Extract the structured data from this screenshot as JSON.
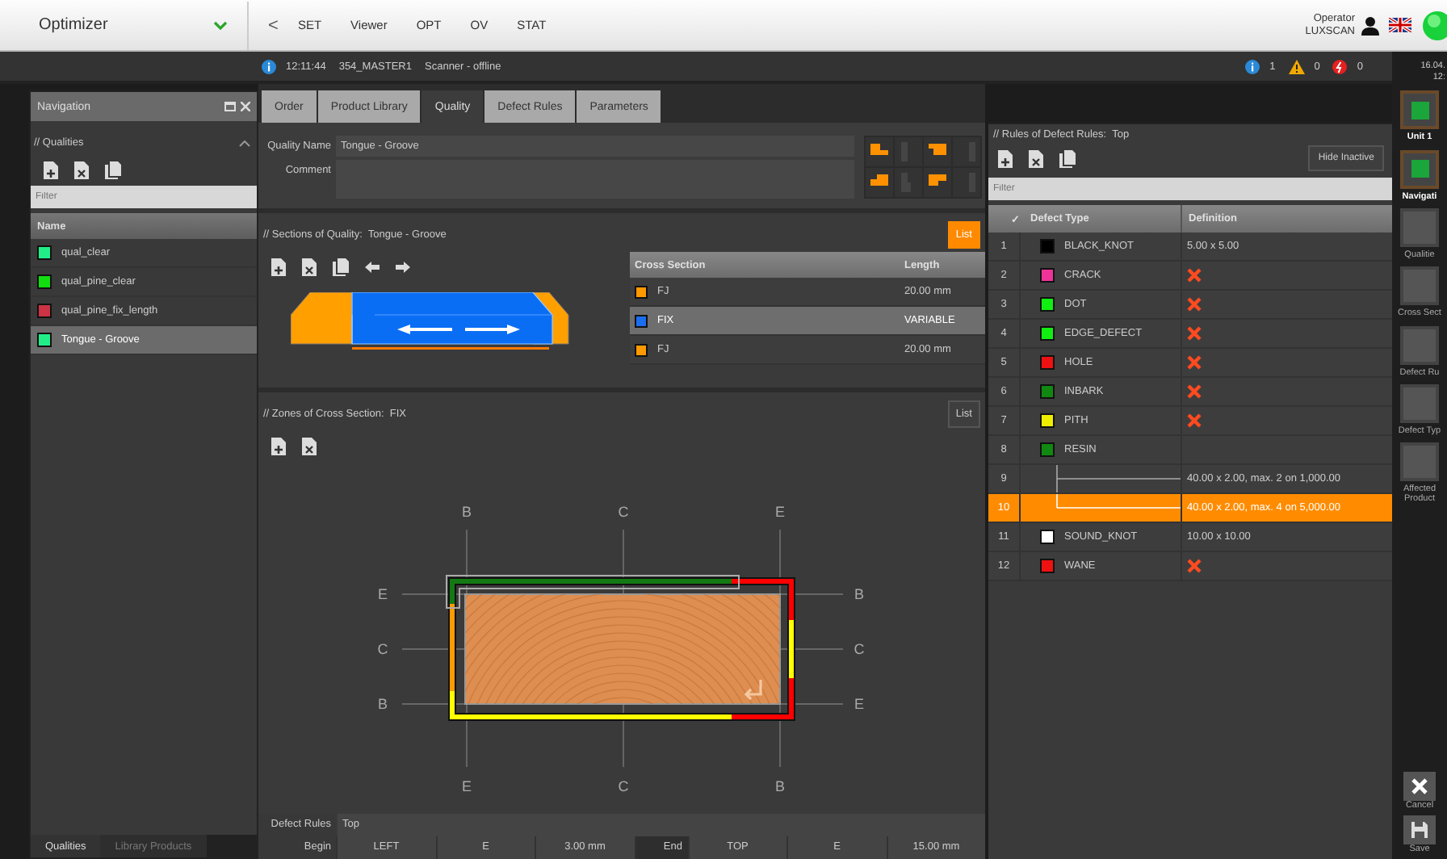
{
  "app": {
    "title": "Optimizer",
    "back": "<",
    "menu": [
      "SET",
      "Viewer",
      "OPT",
      "OV",
      "STAT"
    ],
    "operator_label": "Operator",
    "operator_name": "LUXSCAN"
  },
  "status_bar": {
    "time": "12:11:44",
    "master": "354_MASTER1",
    "scanner": "Scanner - offline",
    "info_count": "1",
    "warning_count": "0",
    "error_count": "0"
  },
  "navigation": {
    "title": "Navigation",
    "section": "// Qualities",
    "expanded": true,
    "filter_placeholder": "Filter",
    "column": "Name",
    "items": [
      {
        "name": "qual_clear",
        "color": "#22ee88",
        "selected": false
      },
      {
        "name": "qual_pine_clear",
        "color": "#11dd11",
        "selected": false
      },
      {
        "name": "qual_pine_fix_length",
        "color": "#cc3344",
        "selected": false
      },
      {
        "name": "Tongue - Groove",
        "color": "#22ee88",
        "selected": true
      }
    ],
    "tabs": [
      {
        "label": "Qualities",
        "selected": true
      },
      {
        "label": "Library Products",
        "selected": false
      }
    ]
  },
  "tabs": [
    {
      "label": "Order",
      "selected": false
    },
    {
      "label": "Product Library",
      "selected": false
    },
    {
      "label": "Quality",
      "selected": true
    },
    {
      "label": "Defect Rules",
      "selected": false
    },
    {
      "label": "Parameters",
      "selected": false
    }
  ],
  "quality": {
    "name_label": "Quality Name",
    "name": "Tongue - Groove",
    "comment_label": "Comment",
    "profiles": [
      {
        "active": true
      },
      {
        "active": false
      },
      {
        "active": true
      },
      {
        "active": false
      },
      {
        "active": true
      },
      {
        "active": false
      },
      {
        "active": true
      },
      {
        "active": false
      }
    ]
  },
  "sections": {
    "title": "// Sections of Quality:",
    "quality": "Tongue - Groove",
    "list_button": "List",
    "list_active": true,
    "columns": [
      "Cross Section",
      "Length"
    ],
    "rows": [
      {
        "name": "FJ",
        "length": "20.00 mm",
        "color": "#ff9900",
        "selected": false
      },
      {
        "name": "FIX",
        "length": "VARIABLE",
        "color": "#1a6ef0",
        "selected": true
      },
      {
        "name": "FJ",
        "length": "20.00 mm",
        "color": "#ff9900",
        "selected": false
      }
    ]
  },
  "zones": {
    "title": "// Zones of Cross Section:",
    "section": "FIX",
    "list_button": "List",
    "list_active": false,
    "labels": {
      "top": [
        "B",
        "C",
        "E"
      ],
      "right": [
        "B",
        "C",
        "E"
      ],
      "bottom": [
        "E",
        "C",
        "B"
      ],
      "left": [
        "E",
        "C",
        "B"
      ]
    },
    "defect_rules_label": "Defect Rules",
    "defect_rules": "Top",
    "begin_label": "Begin",
    "begin": [
      "LEFT",
      "E",
      "3.00 mm"
    ],
    "end_label": "End",
    "end": [
      "TOP",
      "E",
      "15.00 mm"
    ]
  },
  "rules": {
    "title": "// Rules of Defect Rules:",
    "rule_set": "Top",
    "hide_inactive": "Hide Inactive",
    "filter_placeholder": "Filter",
    "check_header": "✓",
    "columns": [
      "Defect Type",
      "Definition"
    ],
    "rows": [
      {
        "number": "1",
        "kind": "type",
        "name": "BLACK_KNOT",
        "color": "#000000",
        "definition": "5.00 x 5.00",
        "forbidden": false,
        "selected": false
      },
      {
        "number": "2",
        "kind": "type",
        "name": "CRACK",
        "color": "#ee3399",
        "forbidden": true,
        "selected": false
      },
      {
        "number": "3",
        "kind": "type",
        "name": "DOT",
        "color": "#11ee11",
        "forbidden": true,
        "selected": false
      },
      {
        "number": "4",
        "kind": "type",
        "name": "EDGE_DEFECT",
        "color": "#11ee11",
        "forbidden": true,
        "selected": false
      },
      {
        "number": "5",
        "kind": "type",
        "name": "HOLE",
        "color": "#ee1111",
        "forbidden": true,
        "selected": false
      },
      {
        "number": "6",
        "kind": "type",
        "name": "INBARK",
        "color": "#118811",
        "forbidden": true,
        "selected": false
      },
      {
        "number": "7",
        "kind": "type",
        "name": "PITH",
        "color": "#eeee00",
        "forbidden": true,
        "selected": false
      },
      {
        "number": "8",
        "kind": "type",
        "name": "RESIN",
        "color": "#118811",
        "forbidden": false,
        "selected": false
      },
      {
        "number": "9",
        "kind": "sub",
        "definition": "40.00 x 2.00, max. 2 on 1,000.00",
        "selected": false
      },
      {
        "number": "10",
        "kind": "sub",
        "definition": "40.00 x 2.00, max. 4 on 5,000.00",
        "selected": true
      },
      {
        "number": "11",
        "kind": "type",
        "name": "SOUND_KNOT",
        "color": "#ffffff",
        "definition": "10.00 x 10.00",
        "forbidden": false,
        "selected": false
      },
      {
        "number": "12",
        "kind": "type",
        "name": "WANE",
        "color": "#ee1111",
        "forbidden": true,
        "selected": false
      }
    ]
  },
  "rail": {
    "date": "16.04.",
    "time": "12:",
    "items": [
      {
        "label": "Unit 1",
        "on": true
      },
      {
        "label": "Navigati",
        "on": true
      },
      {
        "label": "Qualitie",
        "on": false
      },
      {
        "label": "Cross Sect",
        "on": false
      },
      {
        "label": "Defect Ru",
        "on": false
      },
      {
        "label": "Defect Typ",
        "on": false
      },
      {
        "label": "Affected Product",
        "on": false
      }
    ],
    "actions": [
      {
        "kind": "cancel",
        "label": "Cancel"
      },
      {
        "kind": "save",
        "label": "Save"
      }
    ]
  }
}
